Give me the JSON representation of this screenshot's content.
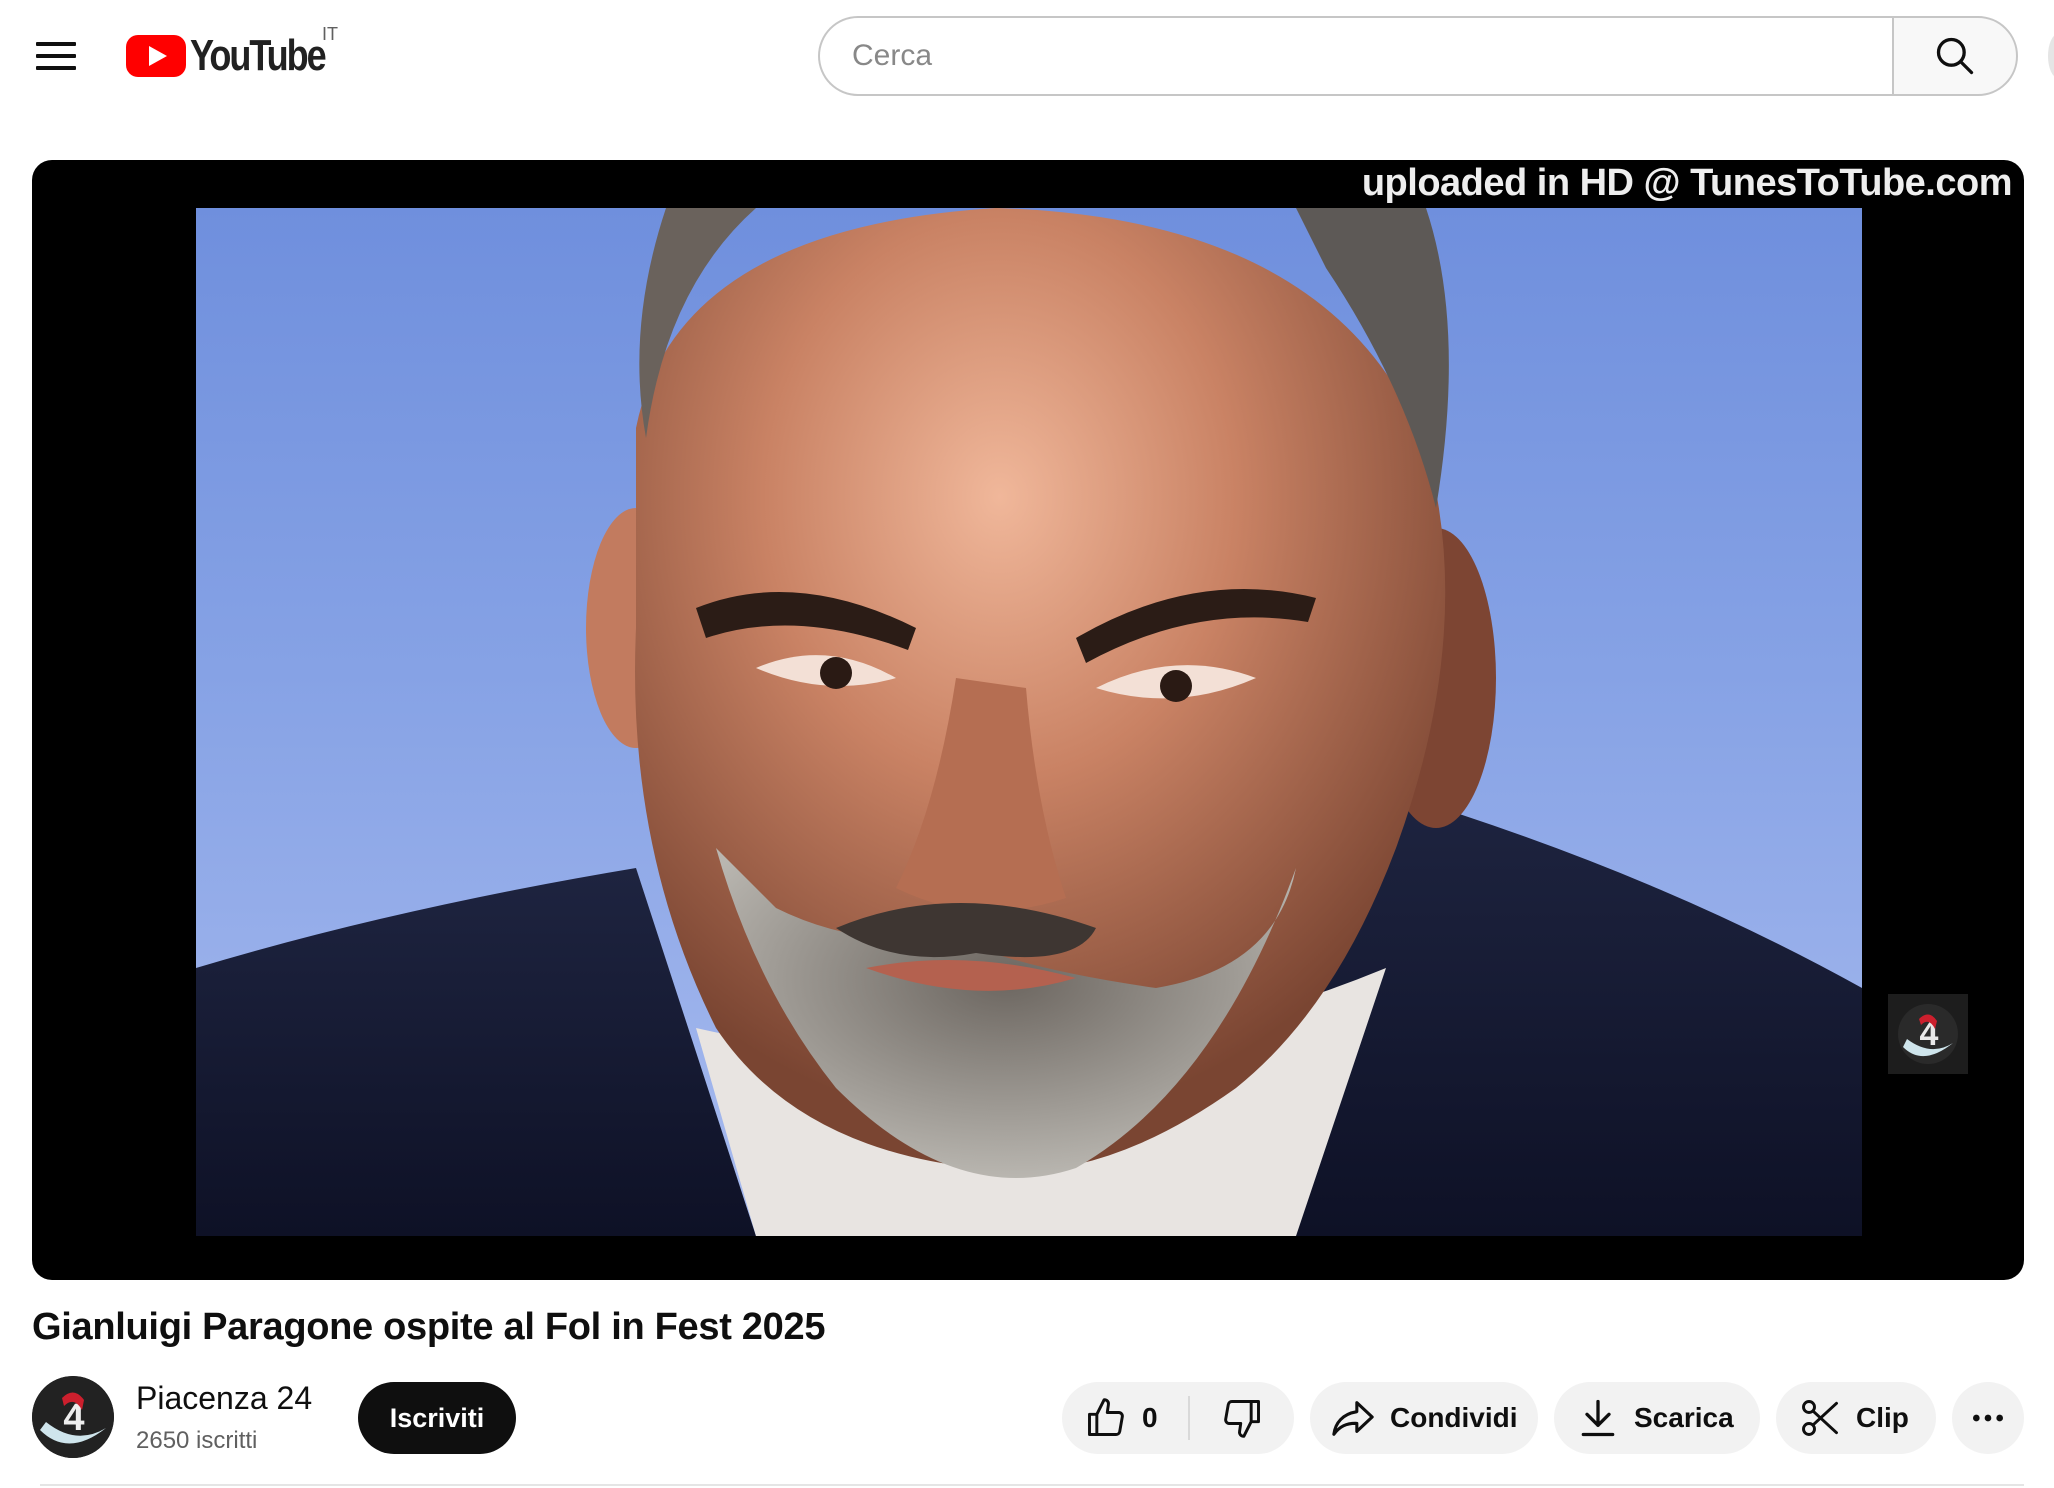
{
  "masthead": {
    "logo_text": "YouTube",
    "country_code": "IT",
    "search": {
      "placeholder": "Cerca",
      "value": ""
    },
    "icons": [
      "menu-icon",
      "youtube-logo-icon",
      "search-icon"
    ]
  },
  "player": {
    "overlay_text": "uploaded in HD @ TunesToTube.com",
    "channel_bug_icon": "piacenza24-logo-icon"
  },
  "video": {
    "title": "Gianluigi Paragone ospite al Fol in Fest 2025"
  },
  "channel": {
    "name": "Piacenza 24",
    "subscribers": "2650 iscritti",
    "subscribe_label": "Iscriviti"
  },
  "actions": {
    "like_count": "0",
    "share_label": "Condividi",
    "download_label": "Scarica",
    "clip_label": "Clip",
    "icons": [
      "thumbs-up-icon",
      "thumbs-down-icon",
      "share-arrow-icon",
      "download-icon",
      "scissors-icon",
      "more-icon"
    ]
  },
  "colors": {
    "brand_red": "#ff0000",
    "text_primary": "#0f0f0f",
    "text_secondary": "#606060",
    "pill_bg": "#f2f2f2",
    "subscribe_bg": "#0f0f0f"
  }
}
